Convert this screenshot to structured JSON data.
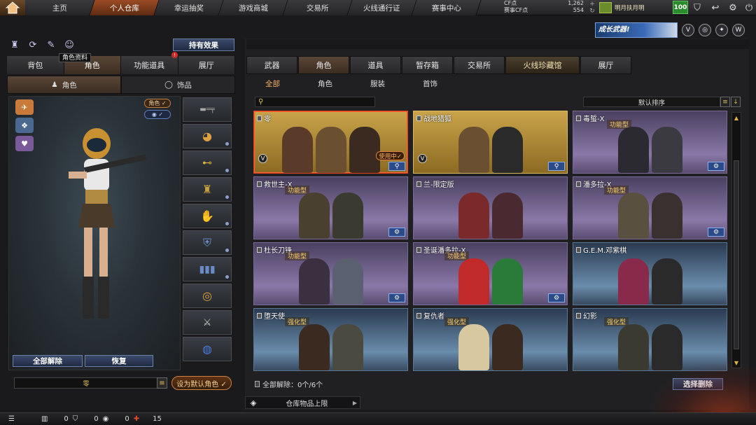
{
  "topbar": {
    "nav": [
      {
        "label": "主页"
      },
      {
        "label": "个人仓库",
        "active": true
      },
      {
        "label": "幸运抽奖"
      },
      {
        "label": "游戏商城"
      },
      {
        "label": "交易所"
      },
      {
        "label": "火线通行证"
      },
      {
        "label": "赛事中心"
      }
    ],
    "cf_points": {
      "label": "CF点",
      "value": "1,262"
    },
    "event_cf_points": {
      "label": "赛事CF点",
      "value": "554"
    },
    "month_card": "明月扶月明",
    "hp_badge": "100"
  },
  "banner": {
    "text": "成长武器!"
  },
  "left": {
    "tooltip": "角色资料",
    "hold_effect": "持有效果",
    "alert": "!",
    "tabs": [
      "背包",
      "角色",
      "功能道具",
      "展厅"
    ],
    "sub_tabs": [
      "角色",
      "饰品"
    ],
    "toggles": {
      "role": "角色 ✓",
      "eye": "◉ ✓"
    },
    "unequip_all": "全部解除",
    "restore": "恢复",
    "name_field": "零",
    "set_default": "设为默认角色 ✓"
  },
  "right": {
    "tabs": [
      "武器",
      "角色",
      "道具",
      "暂存箱",
      "交易所",
      "火线珍藏馆",
      "展厅"
    ],
    "filters": [
      "全部",
      "角色",
      "服装",
      "首饰"
    ],
    "sort": "默认排序",
    "cards": [
      {
        "name": "零",
        "style": "gold",
        "selected": true,
        "in_use": "使用中✓",
        "v": true,
        "tag": ""
      },
      {
        "name": "战地猎狐",
        "style": "gold",
        "v": true,
        "tag": ""
      },
      {
        "name": "毒蜇-X",
        "style": "purple",
        "tag": "功能型"
      },
      {
        "name": "救世主-X",
        "style": "purple",
        "tag": "功能型"
      },
      {
        "name": "兰-限定版",
        "style": "purple",
        "tag": ""
      },
      {
        "name": "潘多拉-X",
        "style": "purple",
        "tag": "功能型"
      },
      {
        "name": "杜长刀锋",
        "style": "purple",
        "tag": "功能型"
      },
      {
        "name": "圣诞潘多拉-X",
        "style": "purple",
        "tag": "功能型"
      },
      {
        "name": "G.E.M.邓紫棋",
        "style": "blue",
        "tag": ""
      },
      {
        "name": "堕天使",
        "style": "blue",
        "tag": "强化型"
      },
      {
        "name": "复仇者",
        "style": "blue",
        "tag": "强化型"
      },
      {
        "name": "幻影",
        "style": "blue",
        "tag": "强化型"
      }
    ],
    "unequip_status": "全部解除：0个/6个",
    "select_delete": "选择删除",
    "storage_limit": "仓库物品上限"
  },
  "bottombar": {
    "counts": [
      "0",
      "0",
      "0",
      "15"
    ]
  },
  "colors": {
    "accent_orange": "#9b4b24",
    "gold_card": "#c9a44a",
    "purple_card": "#8a78a8",
    "blue_card": "#6a8cac",
    "in_use": "#ffb060"
  }
}
